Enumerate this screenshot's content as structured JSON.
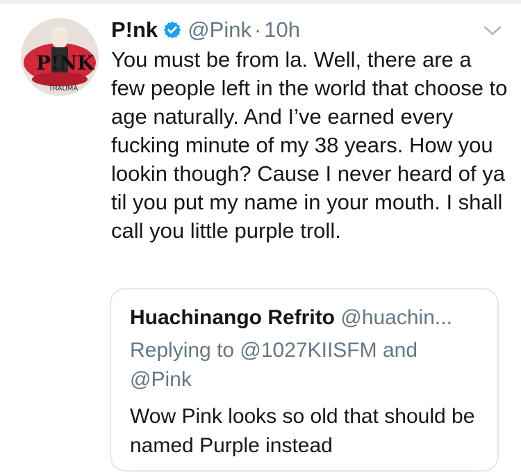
{
  "tweet": {
    "author": {
      "display_name": "P!nk",
      "handle": "@Pink",
      "verified": true,
      "avatar_logo_text": "P!NK",
      "avatar_caption": "TRAUMA"
    },
    "separator": "·",
    "time": "10h",
    "text": "You must be from la. Well, there are a few people left in the world that choose to age naturally. And I’ve earned every fucking minute of my 38 years. How you lookin though? Cause I never heard of ya til you put my name in your mouth. I shall call you little purple troll."
  },
  "quoted_tweet": {
    "display_name": "Huachinango Refrito",
    "handle": "@huachin...",
    "replying_to": "Replying to @1027KIISFM and @Pink",
    "text": "Wow Pink looks so old that should be named Purple instead"
  },
  "colors": {
    "verified_badge": "#1da1f2",
    "secondary_text": "#657786",
    "primary_text": "#14171a",
    "card_border": "#e1e8ed"
  },
  "icons": {
    "verified": "verified-badge-icon",
    "menu": "chevron-down-icon"
  }
}
